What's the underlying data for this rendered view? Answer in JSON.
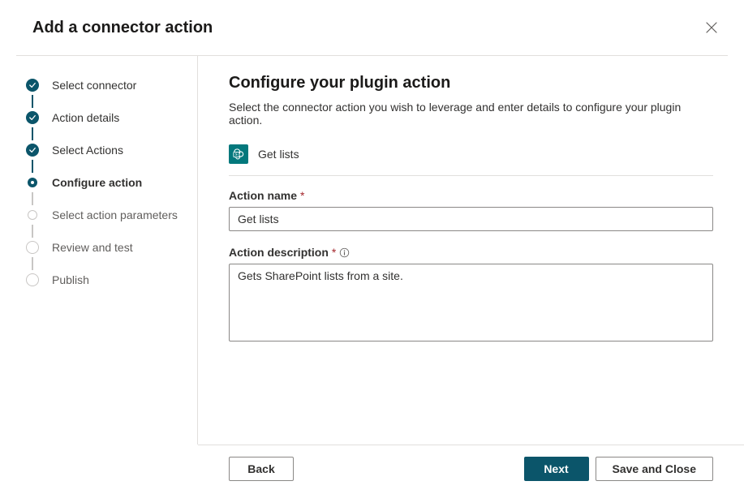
{
  "header": {
    "title": "Add a connector action"
  },
  "steps": [
    {
      "label": "Select connector",
      "state": "done"
    },
    {
      "label": "Action details",
      "state": "done"
    },
    {
      "label": "Select Actions",
      "state": "done"
    },
    {
      "label": "Configure action",
      "state": "current"
    },
    {
      "label": "Select action parameters",
      "state": "next"
    },
    {
      "label": "Review and test",
      "state": "future"
    },
    {
      "label": "Publish",
      "state": "future"
    }
  ],
  "main": {
    "heading": "Configure your plugin action",
    "subheading": "Select the connector action you wish to leverage and enter details to configure your plugin action.",
    "action_chip": {
      "icon": "sharepoint-icon",
      "label": "Get lists"
    },
    "fields": {
      "name": {
        "label": "Action name",
        "required_mark": "*",
        "value": "Get lists"
      },
      "description": {
        "label": "Action description",
        "required_mark": "*",
        "value": "Gets SharePoint lists from a site."
      }
    }
  },
  "footer": {
    "back": "Back",
    "next": "Next",
    "save_close": "Save and Close"
  },
  "colors": {
    "accent": "#0b556a",
    "sharepoint": "#03787c"
  }
}
